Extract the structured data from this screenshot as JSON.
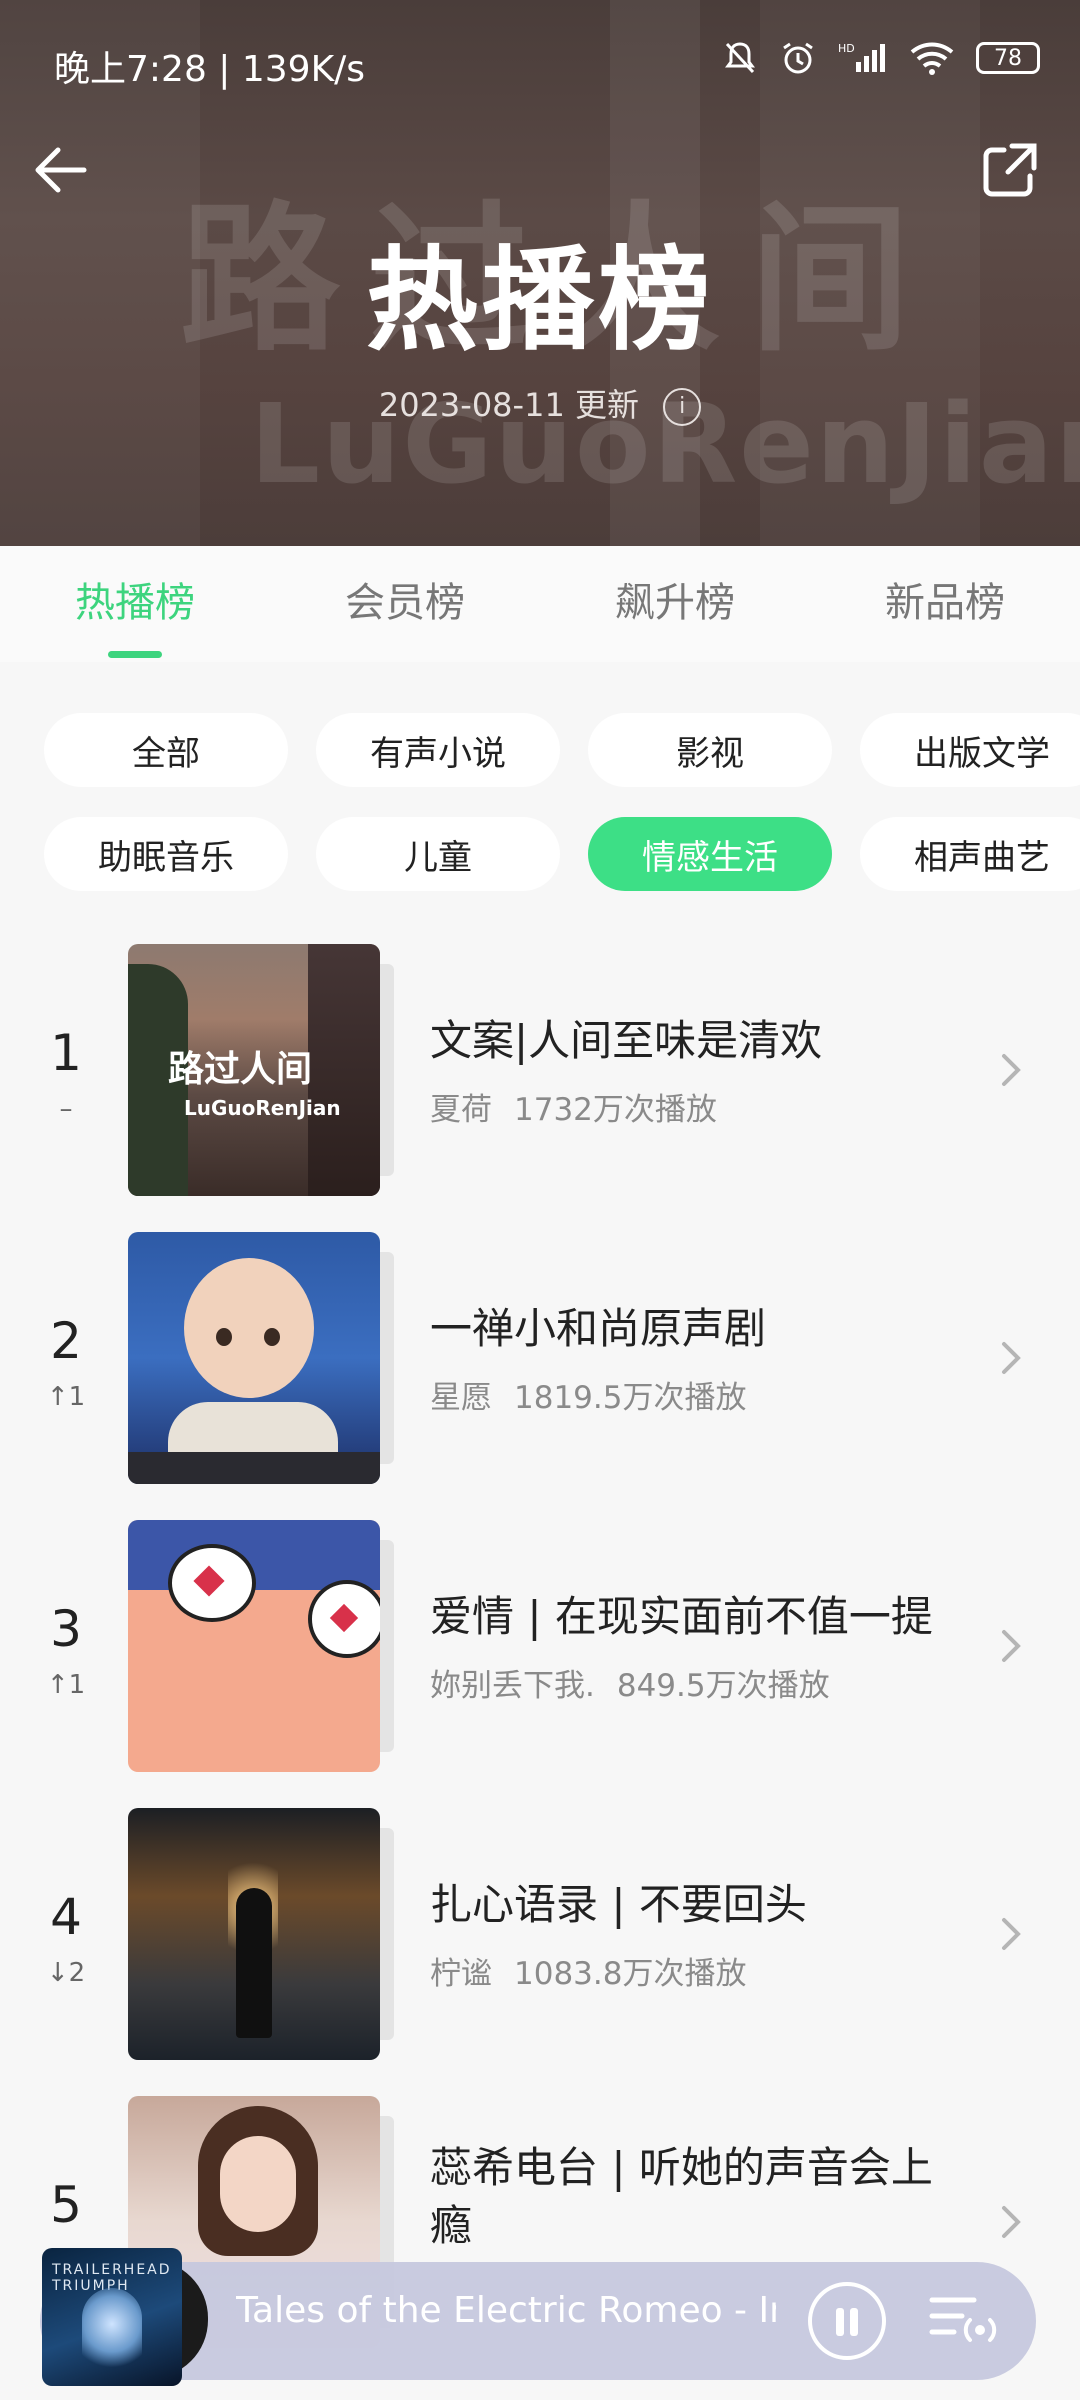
{
  "status_bar": {
    "time_speed": "晚上7:28 | 139K/s",
    "battery": "78"
  },
  "header": {
    "title": "热播榜",
    "update_text": "2023-08-11 更新",
    "bg_title": "路过人间",
    "bg_subtitle": "LuGuoRenJian"
  },
  "tabs": [
    {
      "label": "热播榜",
      "active": true
    },
    {
      "label": "会员榜",
      "active": false
    },
    {
      "label": "飙升榜",
      "active": false
    },
    {
      "label": "新品榜",
      "active": false
    }
  ],
  "chips_row1": [
    "全部",
    "有声小说",
    "影视",
    "出版文学"
  ],
  "chips_row2": [
    "助眠音乐",
    "儿童",
    "情感生活",
    "相声曲艺"
  ],
  "active_chip": "情感生活",
  "items": [
    {
      "rank": "1",
      "change": "–",
      "title": "文案|人间至味是清欢",
      "author": "夏荷",
      "plays": "1732万次播放",
      "cover_text": "路过人间",
      "cover_sub": "LuGuoRenJian"
    },
    {
      "rank": "2",
      "change": "↑1",
      "title": "一禅小和尚原声剧",
      "author": "星愿",
      "plays": "1819.5万次播放"
    },
    {
      "rank": "3",
      "change": "↑1",
      "title": "爱情 | 在现实面前不值一提",
      "author": "妳别丢下我.",
      "plays": "849.5万次播放"
    },
    {
      "rank": "4",
      "change": "↓2",
      "title": "扎心语录 | 不要回头",
      "author": "柠谧",
      "plays": "1083.8万次播放"
    },
    {
      "rank": "5",
      "change": "",
      "title": "蕊希电台 | 听她的声音会上瘾",
      "author": "",
      "plays": ""
    }
  ],
  "player": {
    "title": "Tales of the Electric Romeo - Imr",
    "cover_label": "TRAILERHEAD TRIUMPH"
  },
  "colors": {
    "accent": "#3dd47e",
    "chip_active": "#3ddf86"
  }
}
